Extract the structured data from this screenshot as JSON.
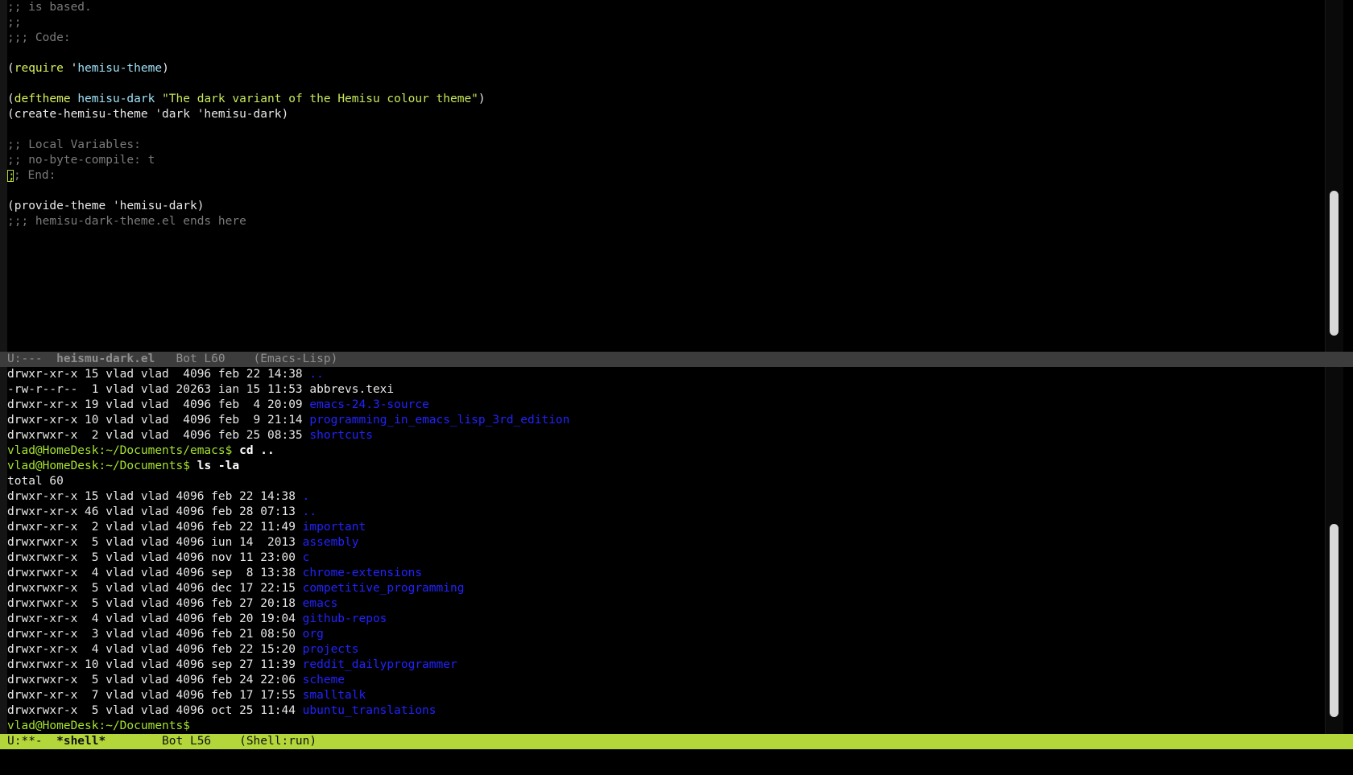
{
  "code_pane": {
    "lines": [
      {
        "segments": [
          {
            "c": "cmt",
            "t": ";; is based."
          }
        ]
      },
      {
        "segments": [
          {
            "c": "cmt",
            "t": ";;"
          }
        ]
      },
      {
        "segments": [
          {
            "c": "cmt",
            "t": ";;; Code:"
          }
        ]
      },
      {
        "segments": []
      },
      {
        "segments": [
          {
            "c": "",
            "t": "("
          },
          {
            "c": "kw",
            "t": "require"
          },
          {
            "c": "",
            "t": " '"
          },
          {
            "c": "fn",
            "t": "hemisu-theme"
          },
          {
            "c": "",
            "t": ")"
          }
        ]
      },
      {
        "segments": []
      },
      {
        "segments": [
          {
            "c": "",
            "t": "("
          },
          {
            "c": "kw",
            "t": "deftheme"
          },
          {
            "c": "",
            "t": " "
          },
          {
            "c": "fn",
            "t": "hemisu-dark"
          },
          {
            "c": "",
            "t": " "
          },
          {
            "c": "str",
            "t": "\"The dark variant of the Hemisu colour theme\""
          },
          {
            "c": "",
            "t": ")"
          }
        ]
      },
      {
        "segments": [
          {
            "c": "",
            "t": "(create-hemisu-theme 'dark 'hemisu-dark)"
          }
        ]
      },
      {
        "segments": []
      },
      {
        "segments": [
          {
            "c": "cmt",
            "t": ";; Local Variables:"
          }
        ]
      },
      {
        "segments": [
          {
            "c": "cmt",
            "t": ";; no-byte-compile: t"
          }
        ]
      },
      {
        "segments": [
          {
            "c": "cursor",
            "t": ";"
          },
          {
            "c": "cmt",
            "t": "; End:"
          }
        ]
      },
      {
        "segments": []
      },
      {
        "segments": [
          {
            "c": "",
            "t": "(provide-theme 'hemisu-dark)"
          }
        ]
      },
      {
        "segments": [
          {
            "c": "cmt",
            "t": ";;; hemisu-dark-theme.el ends here"
          }
        ]
      }
    ]
  },
  "modeline_top": {
    "status": "U:---  ",
    "buffer": "heismu-dark.el",
    "position": "   Bot L60    ",
    "mode": "(Emacs-Lisp)"
  },
  "shell_pane": {
    "lines": [
      {
        "segments": [
          {
            "c": "",
            "t": "drwxr-xr-x 15 vlad vlad  4096 feb 22 14:38 "
          },
          {
            "c": "dir",
            "t": ".."
          }
        ]
      },
      {
        "segments": [
          {
            "c": "",
            "t": "-rw-r--r--  1 vlad vlad 20263 ian 15 11:53 abbrevs.texi"
          }
        ]
      },
      {
        "segments": [
          {
            "c": "",
            "t": "drwxr-xr-x 19 vlad vlad  4096 feb  4 20:09 "
          },
          {
            "c": "dir",
            "t": "emacs-24.3-source"
          }
        ]
      },
      {
        "segments": [
          {
            "c": "",
            "t": "drwxr-xr-x 10 vlad vlad  4096 feb  9 21:14 "
          },
          {
            "c": "dir",
            "t": "programming_in_emacs_lisp_3rd_edition"
          }
        ]
      },
      {
        "segments": [
          {
            "c": "",
            "t": "drwxrwxr-x  2 vlad vlad  4096 feb 25 08:35 "
          },
          {
            "c": "dir",
            "t": "shortcuts"
          }
        ]
      },
      {
        "segments": [
          {
            "c": "prompt",
            "t": "vlad@HomeDesk:~/Documents/emacs$"
          },
          {
            "c": "cmd",
            "t": " cd .."
          }
        ]
      },
      {
        "segments": [
          {
            "c": "prompt",
            "t": "vlad@HomeDesk:~/Documents$"
          },
          {
            "c": "cmd",
            "t": " ls -la"
          }
        ]
      },
      {
        "segments": [
          {
            "c": "",
            "t": "total 60"
          }
        ]
      },
      {
        "segments": [
          {
            "c": "",
            "t": "drwxr-xr-x 15 vlad vlad 4096 feb 22 14:38 "
          },
          {
            "c": "dir",
            "t": "."
          }
        ]
      },
      {
        "segments": [
          {
            "c": "",
            "t": "drwxr-xr-x 46 vlad vlad 4096 feb 28 07:13 "
          },
          {
            "c": "dir",
            "t": ".."
          }
        ]
      },
      {
        "segments": [
          {
            "c": "",
            "t": "drwxr-xr-x  2 vlad vlad 4096 feb 22 11:49 "
          },
          {
            "c": "dir",
            "t": "important"
          }
        ]
      },
      {
        "segments": [
          {
            "c": "",
            "t": "drwxrwxr-x  5 vlad vlad 4096 iun 14  2013 "
          },
          {
            "c": "dir",
            "t": "assembly"
          }
        ]
      },
      {
        "segments": [
          {
            "c": "",
            "t": "drwxrwxr-x  5 vlad vlad 4096 nov 11 23:00 "
          },
          {
            "c": "dir",
            "t": "c"
          }
        ]
      },
      {
        "segments": [
          {
            "c": "",
            "t": "drwxrwxr-x  4 vlad vlad 4096 sep  8 13:38 "
          },
          {
            "c": "dir",
            "t": "chrome-extensions"
          }
        ]
      },
      {
        "segments": [
          {
            "c": "",
            "t": "drwxrwxr-x  5 vlad vlad 4096 dec 17 22:15 "
          },
          {
            "c": "dir",
            "t": "competitive_programming"
          }
        ]
      },
      {
        "segments": [
          {
            "c": "",
            "t": "drwxrwxr-x  5 vlad vlad 4096 feb 27 20:18 "
          },
          {
            "c": "dir",
            "t": "emacs"
          }
        ]
      },
      {
        "segments": [
          {
            "c": "",
            "t": "drwxr-xr-x  4 vlad vlad 4096 feb 20 19:04 "
          },
          {
            "c": "dir",
            "t": "github-repos"
          }
        ]
      },
      {
        "segments": [
          {
            "c": "",
            "t": "drwxr-xr-x  3 vlad vlad 4096 feb 21 08:50 "
          },
          {
            "c": "dir",
            "t": "org"
          }
        ]
      },
      {
        "segments": [
          {
            "c": "",
            "t": "drwxr-xr-x  4 vlad vlad 4096 feb 22 15:20 "
          },
          {
            "c": "dir",
            "t": "projects"
          }
        ]
      },
      {
        "segments": [
          {
            "c": "",
            "t": "drwxrwxr-x 10 vlad vlad 4096 sep 27 11:39 "
          },
          {
            "c": "dir",
            "t": "reddit_dailyprogrammer"
          }
        ]
      },
      {
        "segments": [
          {
            "c": "",
            "t": "drwxrwxr-x  5 vlad vlad 4096 feb 24 22:06 "
          },
          {
            "c": "dir",
            "t": "scheme"
          }
        ]
      },
      {
        "segments": [
          {
            "c": "",
            "t": "drwxr-xr-x  7 vlad vlad 4096 feb 17 17:55 "
          },
          {
            "c": "dir",
            "t": "smalltalk"
          }
        ]
      },
      {
        "segments": [
          {
            "c": "",
            "t": "drwxrwxr-x  5 vlad vlad 4096 oct 25 11:44 "
          },
          {
            "c": "dir",
            "t": "ubuntu_translations"
          }
        ]
      },
      {
        "segments": [
          {
            "c": "prompt",
            "t": "vlad@HomeDesk:~/Documents$"
          },
          {
            "c": "",
            "t": " "
          }
        ]
      }
    ]
  },
  "modeline_bottom": {
    "status": "U:**-  ",
    "buffer": "*shell*",
    "position": "        Bot L56    ",
    "mode": "(Shell:run)"
  }
}
